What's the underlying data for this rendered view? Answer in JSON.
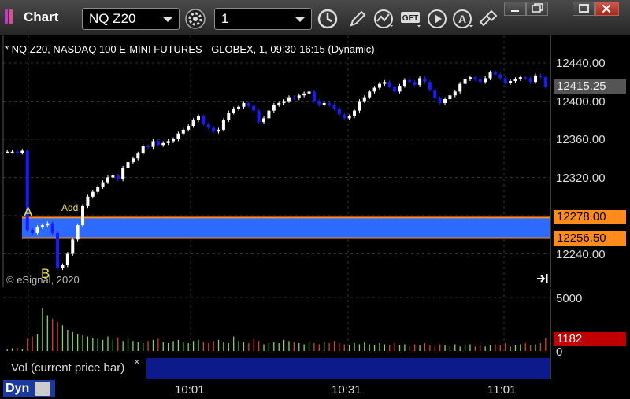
{
  "window": {
    "title": "Chart",
    "symbol": "NQ Z20",
    "interval": "1",
    "buttons": [
      "settings-icon",
      "clock-icon",
      "pencil-icon",
      "indicator-icon",
      "get-icon",
      "play-icon",
      "alert-icon",
      "link-icon",
      "minimize-icon",
      "restore-icon",
      "maximize-icon",
      "close-icon"
    ]
  },
  "chart": {
    "description": "* NQ Z20, NASDAQ 100 E-MINI FUTURES - GLOBEX, 1, 09:30-16:15 (Dynamic)",
    "copyright": "© eSignal, 2020",
    "price_ticks": [
      "12440.00",
      "12400.00",
      "12360.00",
      "12320.00",
      "12240.00"
    ],
    "last_price": "12415.25",
    "level_high": "12278.00",
    "level_low": "12256.50",
    "annotation_a": "A",
    "annotation_b": "B",
    "annotation_add": "Add",
    "volume_tick_top": "5000",
    "volume_tick_bottom": "0",
    "volume_last": "1182",
    "volume_label": "Vol (current price bar)",
    "volume_close": "×",
    "time_ticks": [
      "10:01",
      "10:31",
      "11:01"
    ],
    "dyn_label": "Dyn",
    "colors": {
      "up": "#ffffff",
      "down": "#1a1aff",
      "zone": "#2d6bff",
      "level_line": "#ff8c1a",
      "vol_up": "#7ed957",
      "vol_down": "#e33b2b"
    }
  },
  "chart_data": {
    "type": "candlestick",
    "title": "* NQ Z20, NASDAQ 100 E-MINI FUTURES - GLOBEX, 1, 09:30-16:15 (Dynamic)",
    "ylim": [
      12210,
      12460
    ],
    "x_ticks": [
      "10:01",
      "10:31",
      "11:01"
    ],
    "zone": {
      "low": 12256.5,
      "high": 12278.0
    },
    "last_price": 12415.25,
    "close": [
      12347,
      12347,
      12346,
      12348,
      12265,
      12262,
      12268,
      12270,
      12272,
      12262,
      12225,
      12228,
      12240,
      12255,
      12270,
      12290,
      12300,
      12305,
      12310,
      12315,
      12320,
      12322,
      12318,
      12330,
      12336,
      12340,
      12345,
      12353,
      12352,
      12358,
      12354,
      12356,
      12358,
      12360,
      12366,
      12370,
      12374,
      12380,
      12384,
      12376,
      12372,
      12368,
      12370,
      12380,
      12388,
      12392,
      12394,
      12398,
      12395,
      12390,
      12378,
      12382,
      12390,
      12396,
      12398,
      12400,
      12404,
      12403,
      12406,
      12408,
      12410,
      12400,
      12396,
      12398,
      12396,
      12392,
      12386,
      12382,
      12384,
      12390,
      12400,
      12404,
      12410,
      12414,
      12418,
      12420,
      12415,
      12410,
      12416,
      12422,
      12420,
      12417,
      12424,
      12420,
      12412,
      12403,
      12398,
      12402,
      12406,
      12410,
      12418,
      12423,
      12425,
      12423,
      12420,
      12424,
      12430,
      12428,
      12424,
      12419,
      12421,
      12423,
      12425,
      12424,
      12420,
      12427,
      12425,
      12415
    ],
    "volume_max": 5000,
    "volume": [
      200,
      250,
      300,
      200,
      1100,
      1300,
      1500,
      3800,
      3200,
      2900,
      2600,
      2300,
      1900,
      1700,
      1500,
      1400,
      1300,
      1200,
      1100,
      1000,
      1300,
      1000,
      1200,
      900,
      1100,
      900,
      800,
      700,
      900,
      1000,
      1100,
      800,
      700,
      900,
      1000,
      800,
      700,
      900,
      1000,
      800,
      700,
      900,
      1000,
      800,
      700,
      1300,
      900,
      800,
      700,
      1100,
      900,
      600,
      700,
      800,
      700,
      1000,
      900,
      800,
      700,
      600,
      800,
      700,
      600,
      800,
      700,
      900,
      700,
      600,
      500,
      700,
      600,
      800,
      600,
      500,
      700,
      600,
      500,
      700,
      500,
      600,
      400,
      600,
      500,
      700,
      500,
      400,
      600,
      500,
      400,
      600,
      400,
      500,
      600,
      400,
      500,
      400,
      500,
      600,
      500,
      700,
      400,
      500,
      600,
      700,
      500,
      600,
      700,
      1182
    ]
  }
}
